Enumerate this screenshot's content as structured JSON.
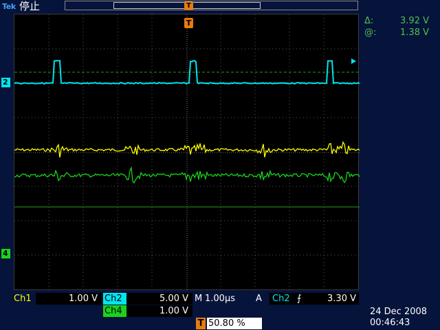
{
  "header": {
    "brand": "Tek",
    "status": "停止",
    "trigger_position_marker": "T",
    "trigger_marker": "T"
  },
  "colors": {
    "ch1": "#ffff00",
    "ch2": "#00e5ee",
    "ch4": "#19d41c",
    "cursor": "#19a31c",
    "trigger": "#e67b10",
    "background": "#06133a"
  },
  "channel_markers": {
    "ch2": "2",
    "ch4": "4"
  },
  "cursor_readout": {
    "delta_symbol": "Δ:",
    "delta_value": "3.92 V",
    "at_symbol": "@:",
    "at_value": "1.38 V"
  },
  "settings": {
    "ch1_label": "Ch1",
    "ch1_scale": "1.00 V",
    "ch2_label": "Ch2",
    "ch2_scale": "5.00 V",
    "ch4_label": "Ch4",
    "ch4_scale": "1.00 V",
    "timebase_prefix": "M",
    "timebase": "1.00µs",
    "trigger_mode": "A",
    "trigger_source": "Ch2",
    "trigger_slope_icon": "rising-edge-icon",
    "trigger_level": "3.30 V",
    "trigger_pos_marker": "T",
    "trigger_position": "50.80 %"
  },
  "datetime": {
    "date": "24 Dec  2008",
    "time": "00:46:43"
  }
}
